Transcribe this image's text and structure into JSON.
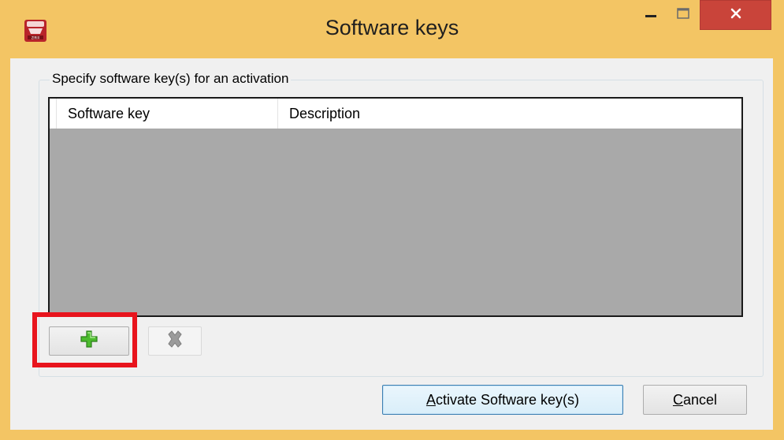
{
  "window": {
    "title": "Software keys",
    "icons": {
      "app": "app-logo-icon",
      "minimize": "minimize-icon",
      "maximize": "maximize-icon",
      "close": "close-icon"
    },
    "colors": {
      "titlebar": "#f3c564",
      "close_button": "#c9443a",
      "highlight": "#e8141d"
    }
  },
  "group": {
    "legend": "Specify software key(s) for an activation"
  },
  "list": {
    "columns": [
      "Software key",
      "Description"
    ],
    "rows": []
  },
  "toolbar": {
    "add_icon": "add-plus-icon",
    "remove_icon": "remove-x-icon"
  },
  "footer": {
    "activate_mnemonic": "A",
    "activate_rest": "ctivate Software key(s)",
    "cancel_mnemonic": "C",
    "cancel_rest": "ancel"
  }
}
